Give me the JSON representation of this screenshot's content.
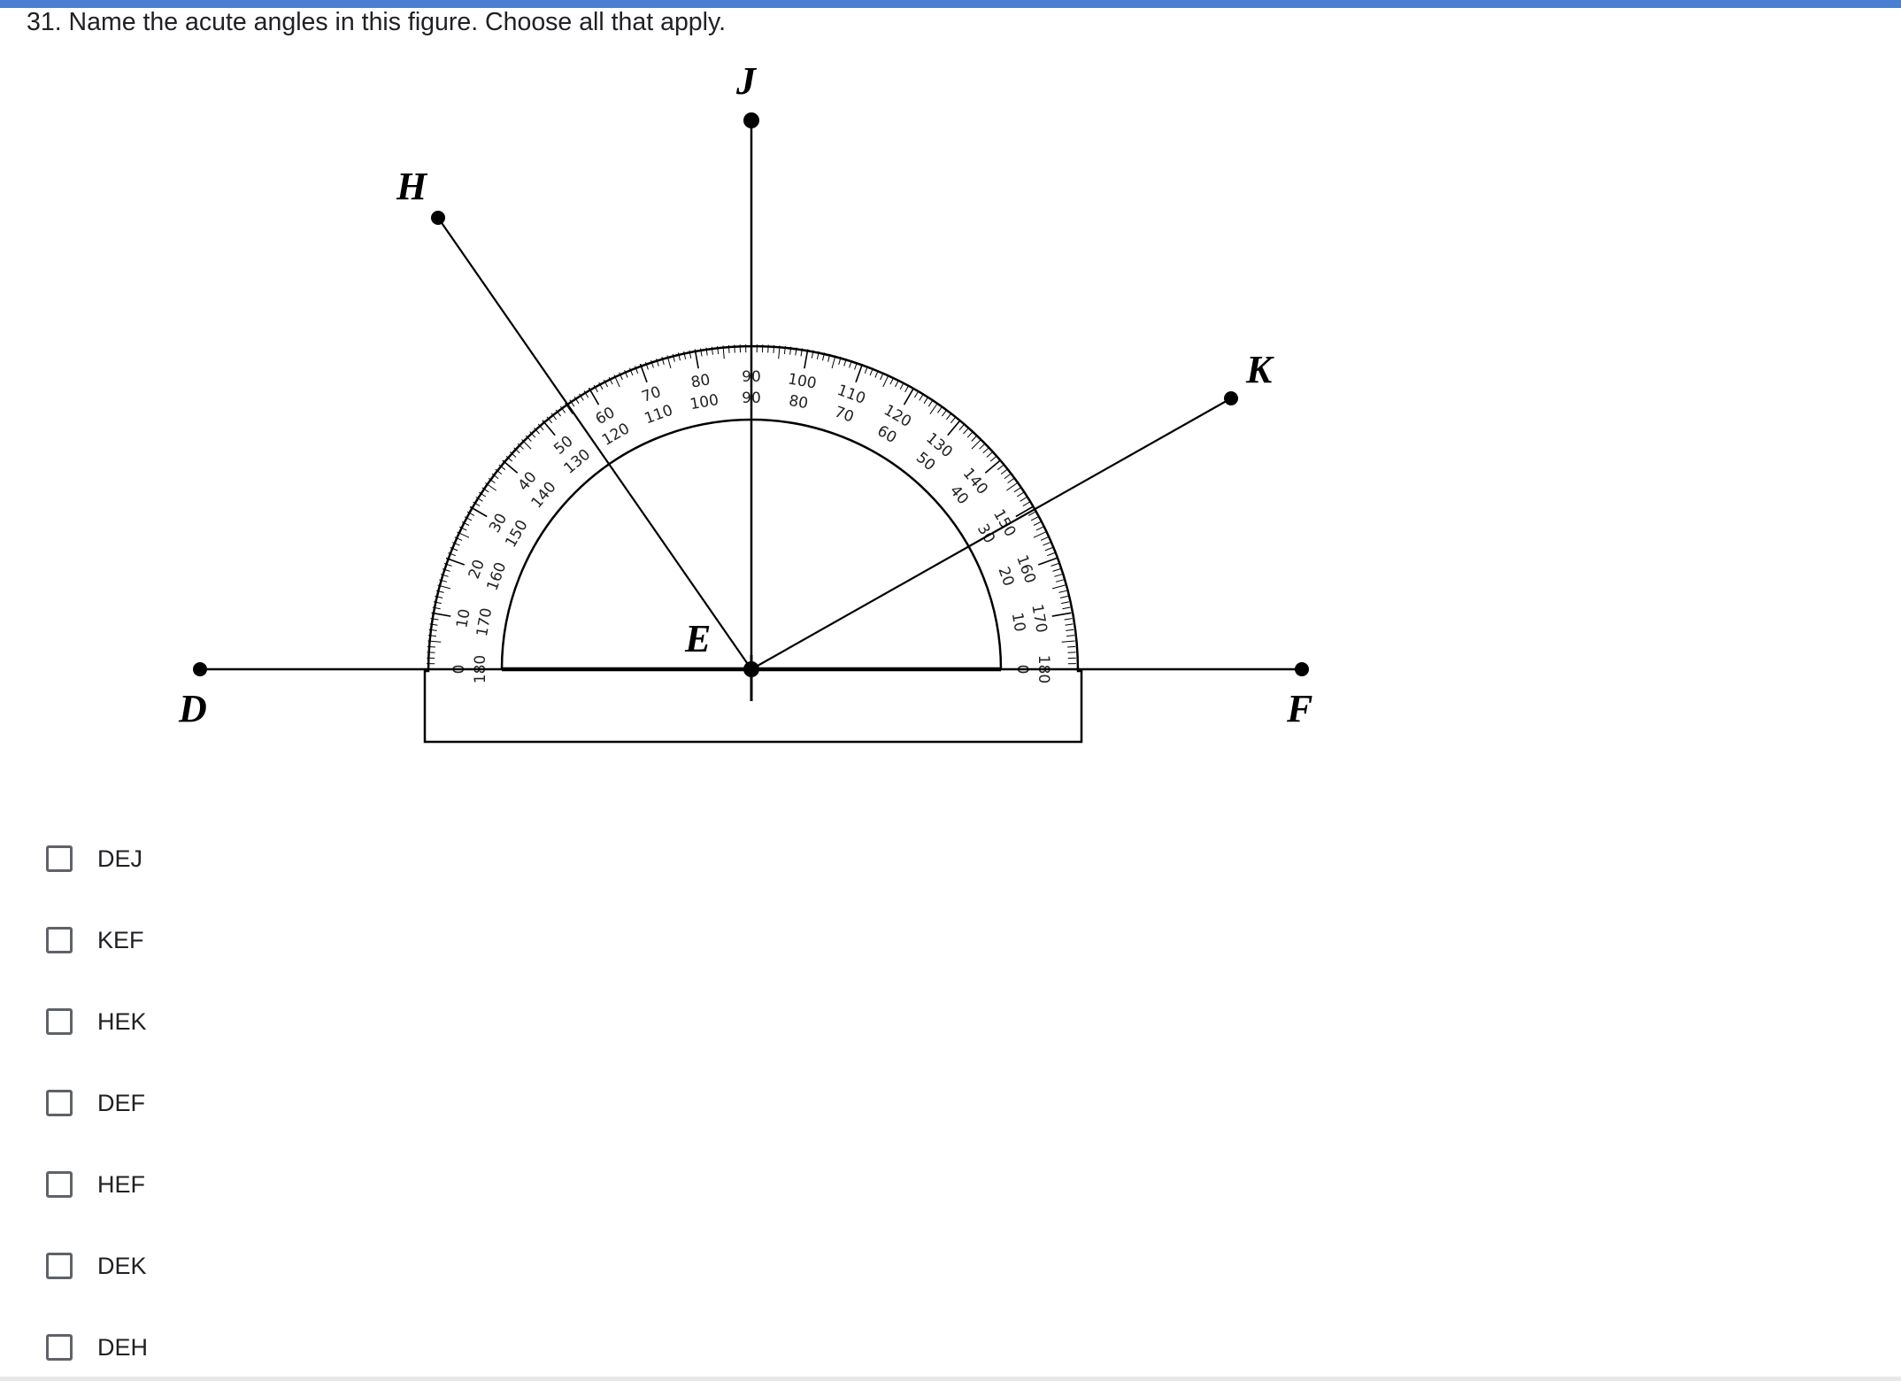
{
  "question": {
    "text": "31. Name the acute angles in this figure. Choose all that apply."
  },
  "figure": {
    "points": {
      "J": "J",
      "H": "H",
      "K": "K",
      "E": "E",
      "D": "D",
      "F": "F"
    },
    "protractor": {
      "outer_scale": [
        "0",
        "10",
        "20",
        "30",
        "40",
        "50",
        "60",
        "70",
        "80",
        "90",
        "100",
        "110",
        "120",
        "130",
        "140",
        "150",
        "160",
        "170",
        "180"
      ],
      "inner_scale": [
        "180",
        "170",
        "160",
        "150",
        "140",
        "130",
        "120",
        "110",
        "100",
        "90",
        "80",
        "70",
        "60",
        "50",
        "40",
        "30",
        "20",
        "10",
        "0"
      ]
    }
  },
  "options": [
    {
      "label": "DEJ",
      "checked": false
    },
    {
      "label": "KEF",
      "checked": false
    },
    {
      "label": "HEK",
      "checked": false
    },
    {
      "label": "DEF",
      "checked": false
    },
    {
      "label": "HEF",
      "checked": false
    },
    {
      "label": "DEK",
      "checked": false
    },
    {
      "label": "DEH",
      "checked": false
    }
  ],
  "colors": {
    "accent_bar": "#4a7fd4",
    "checkbox_border": "#5f6368",
    "text": "#202124"
  }
}
